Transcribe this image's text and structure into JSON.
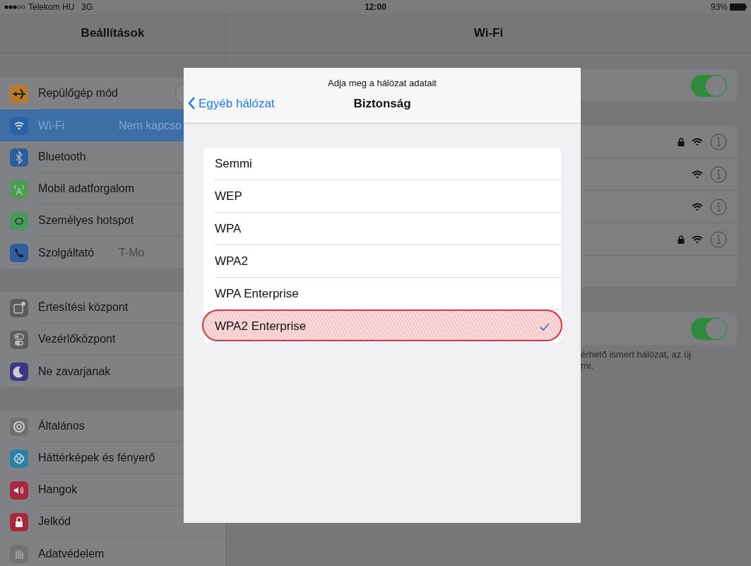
{
  "status_bar": {
    "carrier": "Telekom HU",
    "network": "3G",
    "time": "12:00",
    "battery": "93%"
  },
  "sidebar": {
    "title": "Beállítások",
    "groups": [
      [
        {
          "label": "Repülőgép mód",
          "kind": "toggle",
          "on": false,
          "selected": false,
          "color": "#b97a2c"
        },
        {
          "label": "Wi-Fi",
          "value": "Nem kapcso",
          "kind": "link",
          "selected": true,
          "color": "#2a62a6"
        },
        {
          "label": "Bluetooth",
          "kind": "link",
          "selected": false,
          "color": "#2b5f9e"
        },
        {
          "label": "Mobil adatforgalom",
          "kind": "link",
          "selected": false,
          "color": "#4f9a55"
        },
        {
          "label": "Személyes hotspot",
          "kind": "link",
          "selected": false,
          "color": "#4a9a5e"
        },
        {
          "label": "Szolgáltató",
          "value": "T-Mo",
          "kind": "link",
          "selected": false,
          "color": "#2b5f9e"
        }
      ],
      [
        {
          "label": "Értesítési központ",
          "kind": "link",
          "selected": false,
          "color": "#5a5b5e"
        },
        {
          "label": "Vezérlőközpont",
          "kind": "link",
          "selected": false,
          "color": "#5c5d60"
        },
        {
          "label": "Ne zavarjanak",
          "kind": "link",
          "selected": false,
          "color": "#3b3987"
        }
      ],
      [
        {
          "label": "Általános",
          "kind": "link",
          "selected": false,
          "color": "#6f7073"
        },
        {
          "label": "Háttérképek és fényerő",
          "kind": "link",
          "selected": false,
          "color": "#2e7fa3"
        },
        {
          "label": "Hangok",
          "kind": "link",
          "selected": false,
          "color": "#a8283f"
        },
        {
          "label": "Jelkód",
          "kind": "link",
          "selected": false,
          "color": "#a9283c"
        },
        {
          "label": "Adatvédelem",
          "kind": "link",
          "selected": false,
          "color": "#717275"
        }
      ]
    ]
  },
  "wifi": {
    "title": "Wi-Fi",
    "wifi_toggle": {
      "on": true
    },
    "networks": [
      {
        "locked": true
      },
      {
        "locked": false
      },
      {
        "locked": false
      },
      {
        "locked": true
      }
    ],
    "ask_toggle": {
      "on": true
    },
    "footer_lines": [
      "érhető ismert hálózat, az új",
      "rni."
    ]
  },
  "dialog": {
    "prompt": "Adja meg a hálózat adatait",
    "back": "Egyéb hálózat",
    "title": "Biztonság",
    "options": [
      {
        "label": "Semmi",
        "selected": false
      },
      {
        "label": "WEP",
        "selected": false
      },
      {
        "label": "WPA",
        "selected": false
      },
      {
        "label": "WPA2",
        "selected": false
      },
      {
        "label": "WPA Enterprise",
        "selected": false
      },
      {
        "label": "WPA2 Enterprise",
        "selected": true
      }
    ]
  }
}
